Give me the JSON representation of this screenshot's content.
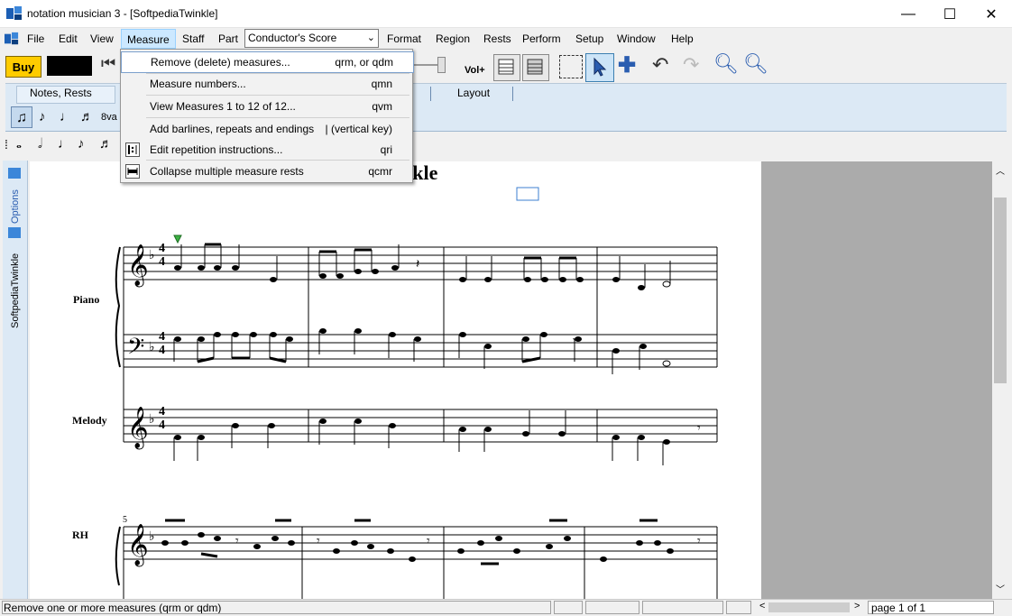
{
  "window": {
    "title": "notation musician 3 - [SoftpediaTwinkle]",
    "minimize": "—",
    "maximize": "☐",
    "close": "✕"
  },
  "menubar": {
    "items": [
      "File",
      "Edit",
      "View",
      "Measure",
      "Staff",
      "Part",
      "Format",
      "Region",
      "Rests",
      "Perform",
      "Setup",
      "Window",
      "Help"
    ],
    "part_selector": "Conductor's Score",
    "mdi_min": "━",
    "mdi_restore": "❐",
    "mdi_close": "✕"
  },
  "toolbar": {
    "buy_label": "Buy",
    "vol_label": "Vol+"
  },
  "tabs": {
    "notes_rests": "Notes, Rests",
    "layout": "Layout"
  },
  "notebar": {
    "ottava": "8va"
  },
  "side": {
    "options": "Options",
    "score_name": "SoftpediaTwinkle"
  },
  "measure_menu": {
    "items": [
      {
        "label": "Remove (delete) measures...",
        "shortcut": "qrm, or qdm"
      },
      {
        "label": "Measure numbers...",
        "shortcut": "qmn"
      },
      {
        "label": "View Measures 1 to 12 of 12...",
        "shortcut": "qvm"
      },
      {
        "label": "Add barlines, repeats and endings",
        "shortcut": "| (vertical key)"
      },
      {
        "label": "Edit repetition instructions...",
        "shortcut": "qri"
      },
      {
        "label": "Collapse multiple measure rests",
        "shortcut": "qcmr"
      }
    ]
  },
  "score": {
    "title_fragment": "winkle",
    "staff_labels": {
      "piano": "Piano",
      "melody": "Melody",
      "rh": "RH"
    },
    "time_sig_top": "4",
    "time_sig_bottom": "4",
    "measure_number": "5"
  },
  "statusbar": {
    "message": "Remove one or more measures (qrm or qdm)",
    "page": "page 1 of 1"
  },
  "colors": {
    "buy_button": "#ffcc00",
    "menu_highlight": "#cce8ff",
    "panel_blue": "#dce9f5",
    "grey_area": "#ababab"
  }
}
